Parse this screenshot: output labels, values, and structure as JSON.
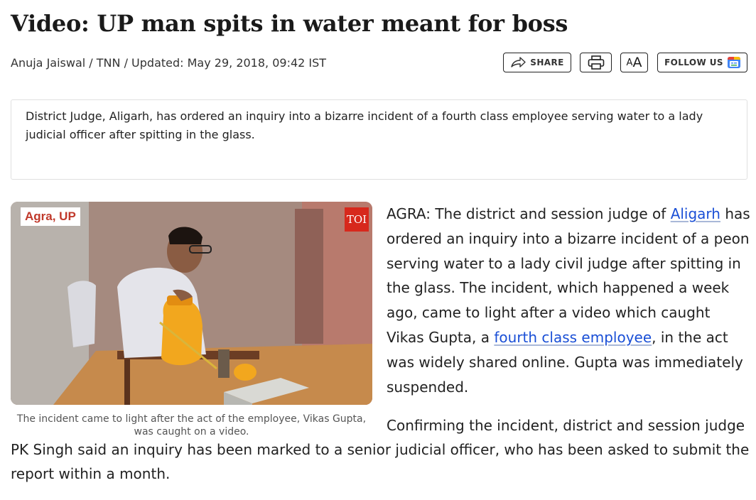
{
  "headline": "Video: UP man spits in water meant for boss",
  "byline": "Anuja Jaiswal / TNN / Updated: May 29, 2018, 09:42 IST",
  "toolbar": {
    "share_label": "SHARE",
    "font_small": "A",
    "font_large": "A",
    "follow_label": "FOLLOW US"
  },
  "summary": "District Judge, Aligarh, has ordered an inquiry into a bizarre incident of a fourth class employee serving water to a lady judicial officer after spitting in the glass.",
  "figure": {
    "location_badge": "Agra, UP",
    "brand_badge": "TOI",
    "caption": "The incident came to light after the act of the employee, Vikas Gupta, was caught on a video."
  },
  "article": {
    "p1_before_link1": "AGRA: The district and session judge of ",
    "p1_link1": "Aligarh",
    "p1_mid": " has ordered an inquiry into a bizarre incident of a peon serving water to a lady civil judge after spitting in the glass. The incident, which happened a week ago, came to light after a video which caught Vikas Gupta, a ",
    "p1_link2": "fourth class employee",
    "p1_after_link2": ", in the act was widely shared online. Gupta was immediately suspended.",
    "p2_first_line": "Confirming the incident, district and session judge",
    "p2_rest": "PK Singh said an inquiry has been marked to a senior judicial officer, who has been asked to submit the report within a month."
  },
  "colors": {
    "link": "#1a4fd6",
    "location_badge_text": "#c0392b",
    "toi_red": "#d7281c"
  }
}
